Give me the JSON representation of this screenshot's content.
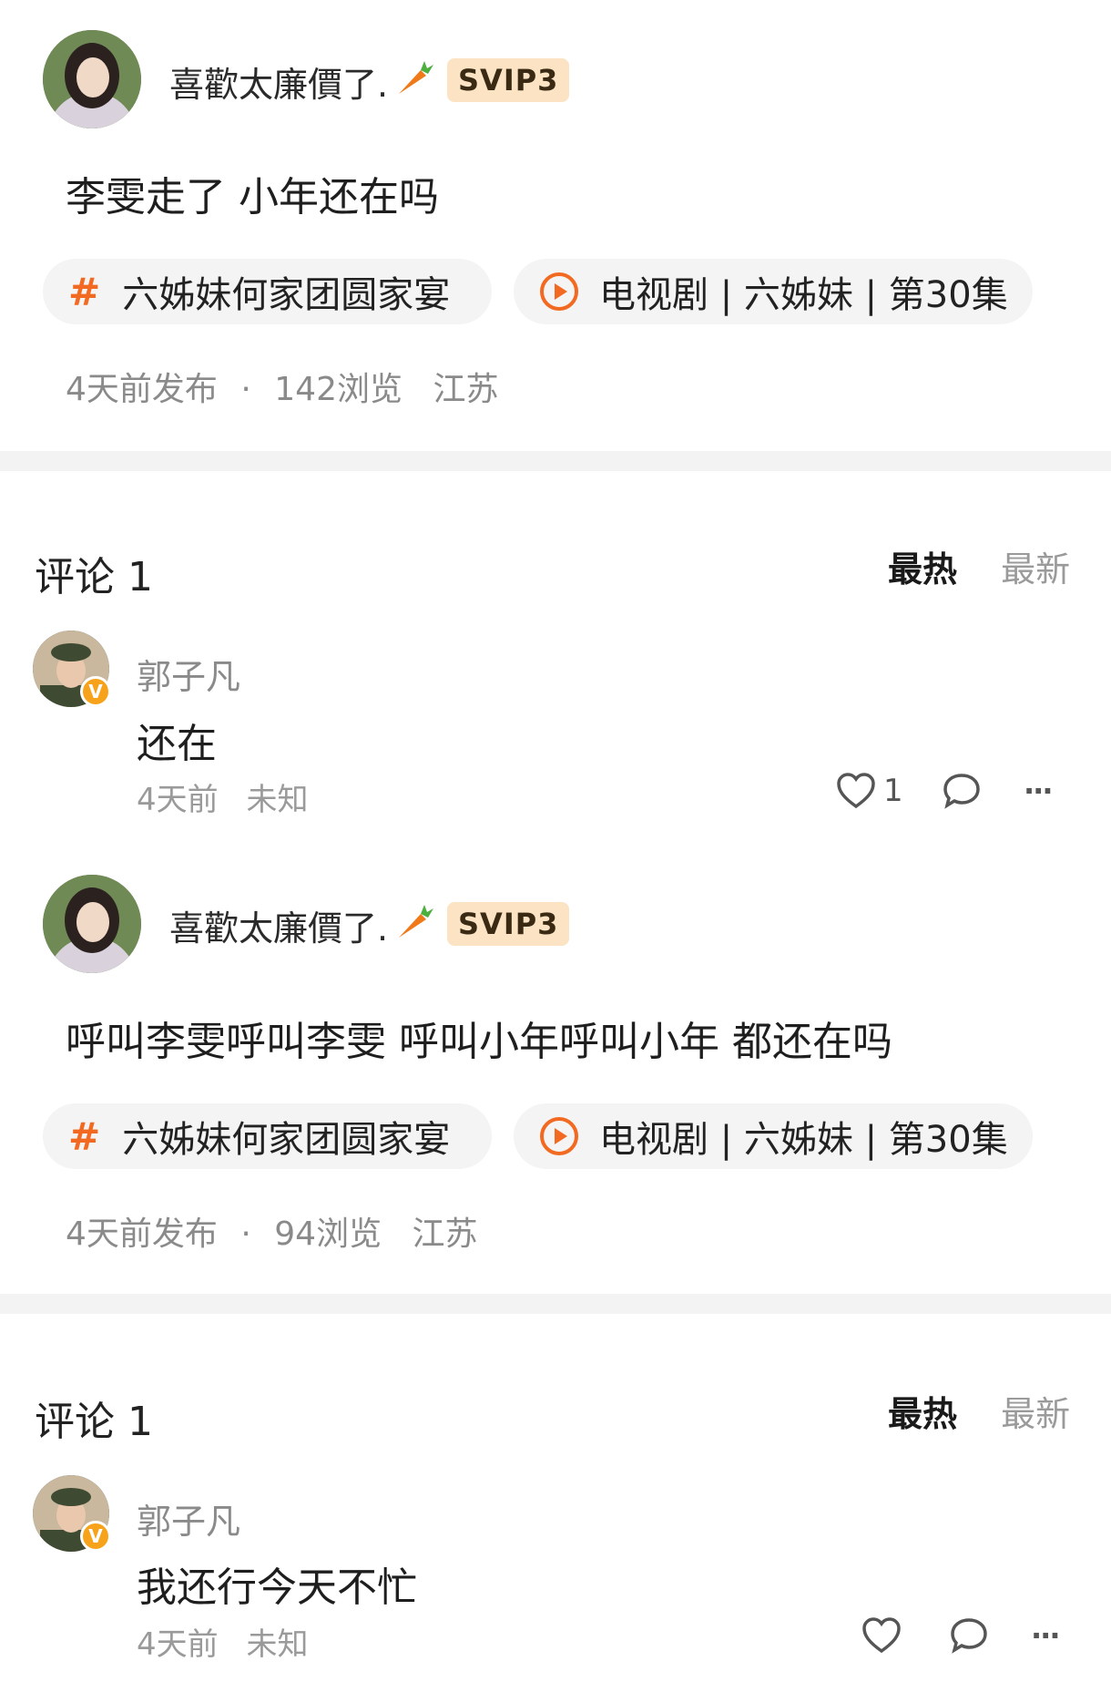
{
  "posts": [
    {
      "username": "喜歡太廉價了.",
      "badge": "SVIP3",
      "text": "李雯走了 小年还在吗",
      "topic_tag": "六姊妹何家团圆家宴",
      "video_tag": "电视剧 | 六姊妹 | 第30集",
      "published": "4天前发布",
      "views": "142浏览",
      "location": "江苏",
      "comments_title": "评论 1",
      "sort_hot": "最热",
      "sort_new": "最新",
      "comment": {
        "author": "郭子凡",
        "text": "还在",
        "time": "4天前",
        "location": "未知",
        "likes": "1"
      }
    },
    {
      "username": "喜歡太廉價了.",
      "badge": "SVIP3",
      "text": "呼叫李雯呼叫李雯 呼叫小年呼叫小年 都还在吗",
      "topic_tag": "六姊妹何家团圆家宴",
      "video_tag": "电视剧 | 六姊妹 | 第30集",
      "published": "4天前发布",
      "views": "94浏览",
      "location": "江苏",
      "comments_title": "评论 1",
      "sort_hot": "最热",
      "sort_new": "最新",
      "comment": {
        "author": "郭子凡",
        "text": "我还行今天不忙",
        "time": "4天前",
        "location": "未知",
        "likes": ""
      }
    }
  ],
  "icons": {
    "hash": "#",
    "separator": "·",
    "more": "···"
  },
  "colors": {
    "accent_orange": "#f26a21",
    "svip_bg": "#fbe3c4",
    "verified_badge": "#f7a21b"
  }
}
